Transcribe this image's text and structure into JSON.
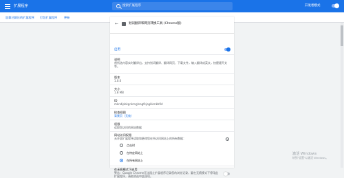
{
  "app": {
    "title": "扩展程序"
  },
  "search": {
    "placeholder": "搜索扩展程序"
  },
  "devmode": {
    "label": "开发者模式",
    "on": true
  },
  "toolbar": {
    "load_unpacked": "加载已解压的扩展程序",
    "pack": "打包扩展程序",
    "update": "更新"
  },
  "extension": {
    "title": "划词翻译和网页转换工具 (Chrome版)",
    "enabled_label": "启用",
    "enabled": true,
    "description_label": "说明",
    "description": "将所选内容实时翻译出，支持划词翻译、翻译网页、下载文件，输入翻译成英文，快捷键开关等。",
    "version_label": "版本",
    "version": "1.0.0",
    "size_label": "大小",
    "size": "1.8 MB",
    "id_label": "ID",
    "id": "mkndipbkgnkmglnagfkjogkkmkbfid",
    "views_label": "检查视图",
    "views": "背景页（无效）",
    "permissions_label": "权限",
    "permissions": "读取您访问的网站数据"
  },
  "site_access": {
    "heading": "网站访问权限",
    "question": "允许此扩展程序读取和更改您在所访问网站上的所有数据：",
    "options": [
      "点击时",
      "在特定网站上",
      "在所有网站上"
    ],
    "selected_index": 2
  },
  "incognito": {
    "label": "在无痕模式下启用",
    "text": "警告：Google Chrome无法阻止扩展程序记录您的浏览记录，要在无痕模式下停用此扩展程序，请取消选中此选项。",
    "enabled": false
  },
  "watermark": {
    "line1": "激活 Windows",
    "line2": "转到\"设置\"以激活 Windows。"
  }
}
